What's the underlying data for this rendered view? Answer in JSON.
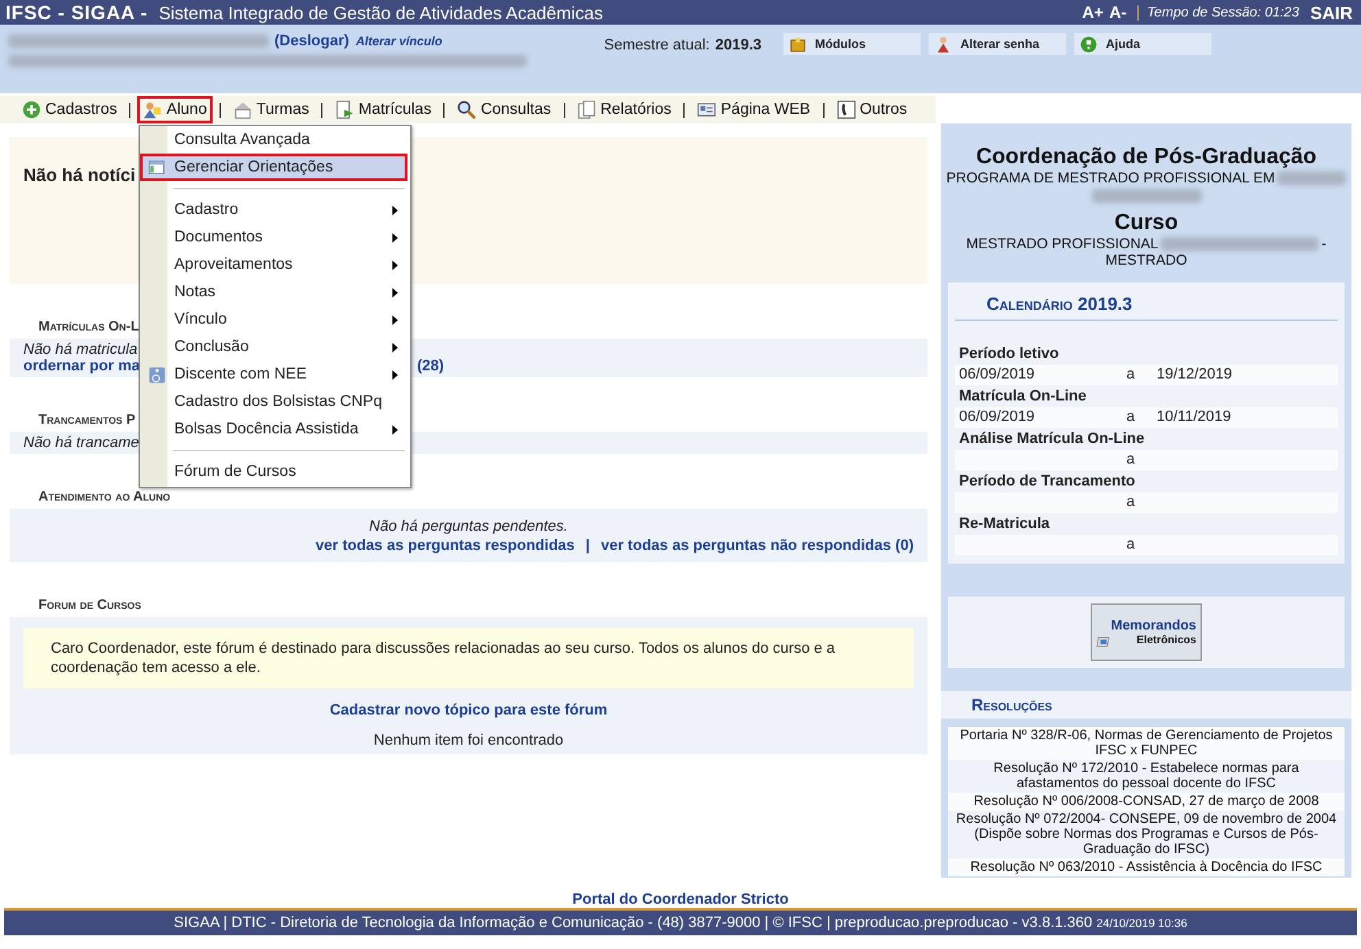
{
  "top_bar": {
    "brand": "IFSC - SIGAA -",
    "system_name": "Sistema Integrado de Gestão de Atividades Acadêmicas",
    "font_up": "A+",
    "font_down": "A-",
    "session": "Tempo de Sessão: 01:23",
    "logout": "SAIR"
  },
  "user_info": {
    "logout_link": "(Deslogar)",
    "change_link": "Alterar vínculo",
    "semester_label": "Semestre atual:",
    "semester": "2019.3",
    "buttons": [
      "Módulos",
      "Alterar senha",
      "Ajuda"
    ]
  },
  "menu_bar": [
    {
      "label": "Cadastros",
      "selected": false
    },
    {
      "label": "Aluno",
      "selected": true
    },
    {
      "label": "Turmas",
      "selected": false
    },
    {
      "label": "Matrículas",
      "selected": false
    },
    {
      "label": "Consultas",
      "selected": false
    },
    {
      "label": "Relatórios",
      "selected": false
    },
    {
      "label": "Página WEB",
      "selected": false
    },
    {
      "label": "Outros",
      "selected": false
    }
  ],
  "dropdown": [
    {
      "kind": "item",
      "label": "Consulta Avançada",
      "submenu": false,
      "selected": false
    },
    {
      "kind": "item",
      "label": "Gerenciar Orientações",
      "submenu": false,
      "selected": true
    },
    {
      "kind": "separator"
    },
    {
      "kind": "item",
      "label": "Cadastro",
      "submenu": true,
      "selected": false
    },
    {
      "kind": "item",
      "label": "Documentos",
      "submenu": true,
      "selected": false
    },
    {
      "kind": "item",
      "label": "Aproveitamentos",
      "submenu": true,
      "selected": false
    },
    {
      "kind": "item",
      "label": "Notas",
      "submenu": true,
      "selected": false
    },
    {
      "kind": "item",
      "label": "Vínculo",
      "submenu": true,
      "selected": false
    },
    {
      "kind": "item",
      "label": "Conclusão",
      "submenu": true,
      "selected": false
    },
    {
      "kind": "item",
      "label": "Discente com NEE",
      "submenu": true,
      "selected": false
    },
    {
      "kind": "item",
      "label": "Cadastro dos Bolsistas CNPq",
      "submenu": false,
      "selected": false
    },
    {
      "kind": "item",
      "label": "Bolsas Docência Assistida",
      "submenu": true,
      "selected": false
    },
    {
      "kind": "separator"
    },
    {
      "kind": "item",
      "label": "Fórum de Cursos",
      "submenu": false,
      "selected": false
    }
  ],
  "notice": "Não há notíci",
  "sections": [
    {
      "heading": "Matrículas On-L",
      "lines": [
        {
          "kind": "note",
          "text": "Não há matricula"
        },
        {
          "kind": "link",
          "text": "ordernar por ma",
          "tail": "(28)"
        }
      ]
    },
    {
      "heading": "Trancamentos P",
      "lines": [
        {
          "kind": "note",
          "text": "Não há trancame"
        }
      ]
    },
    {
      "heading": "Atendimento ao Aluno",
      "lines": [
        {
          "kind": "center_note",
          "text": "Não há perguntas pendentes."
        },
        {
          "kind": "links",
          "links": [
            "ver todas as perguntas respondidas",
            "ver todas as perguntas não respondidas (0)"
          ],
          "separator": "|"
        }
      ]
    }
  ],
  "forum": {
    "heading": "Forum de Cursos",
    "message": "Caro Coordenador, este fórum é destinado para discussões relacionadas ao seu curso. Todos os alunos do curso e a coordenação tem acesso a ele.",
    "new_topic": "Cadastrar novo tópico para este fórum",
    "empty": "Nenhum item foi encontrado"
  },
  "sidebar": {
    "title": "Coordenação de Pós-Graduação",
    "program": "PROGRAMA DE MESTRADO PROFISSIONAL EM",
    "course_heading": "Curso",
    "course": "MESTRADO PROFISSIONAL",
    "course_dash": "-",
    "course_end": "MESTRADO",
    "calendar": {
      "title": "Calendário 2019.3",
      "rows": [
        {
          "label": "Período letivo",
          "start": "06/09/2019",
          "to": "a",
          "end": "19/12/2019"
        },
        {
          "label": "Matrícula On-Line",
          "start": "06/09/2019",
          "to": "a",
          "end": "10/11/2019"
        },
        {
          "label": "Análise Matrícula On-Line",
          "to": "a"
        },
        {
          "label": "Período de Trancamento",
          "to": "a"
        },
        {
          "label": "Re-Matricula",
          "to": "a"
        }
      ]
    },
    "memo_button": [
      "Memorandos",
      "Eletrônicos"
    ],
    "resolutions_title": "Resoluções",
    "resolutions": [
      "Portaria Nº 328/R-06, Normas de Gerenciamento de Projetos IFSC x FUNPEC",
      "Resolução Nº 172/2010 - Estabelece normas para afastamentos do pessoal docente do IFSC",
      "Resolução Nº 006/2008-CONSAD, 27 de março de 2008",
      "Resolução Nº 072/2004- CONSEPE, 09 de novembro de 2004 (Dispõe sobre Normas dos Programas e Cursos de Pós-Graduação do IFSC)",
      "Resolução Nº 063/2010 - Assistência à Docência do IFSC"
    ]
  },
  "footer": {
    "portal_link": "Portal do Coordenador Stricto",
    "text": "SIGAA | DTIC - Diretoria de Tecnologia da Informação e Comunicação - (48) 3877-9000 | © IFSC | preproducao.preproducao - v3.8.1.360",
    "timestamp": "24/10/2019 10:36"
  }
}
